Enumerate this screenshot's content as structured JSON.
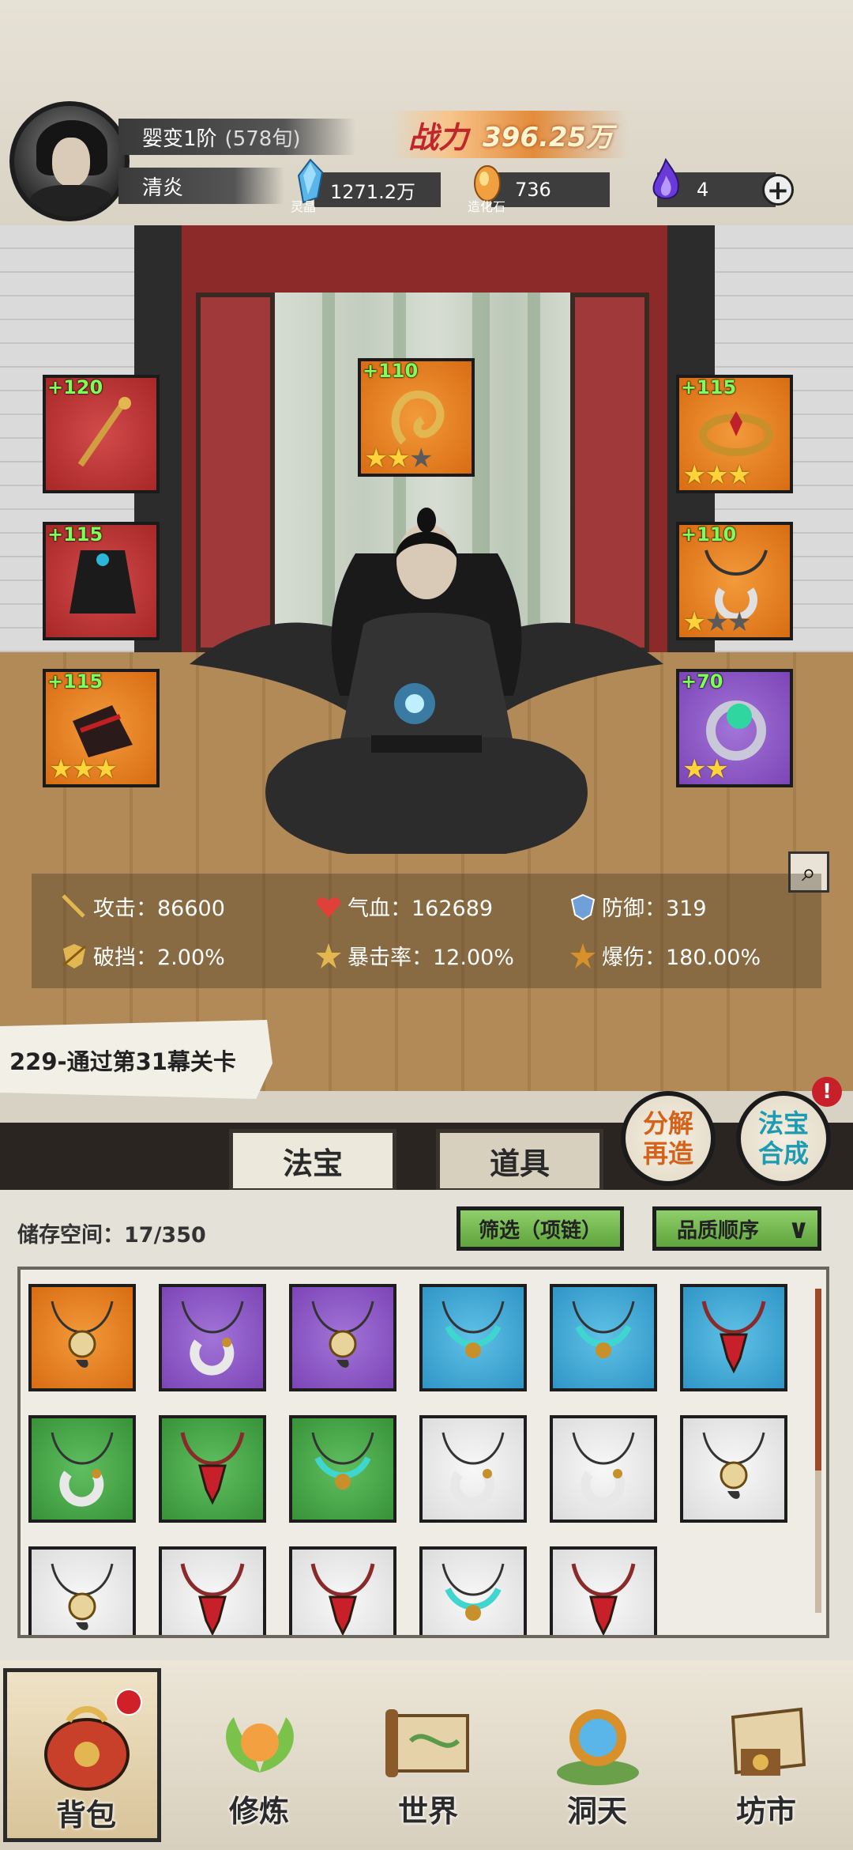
{
  "player": {
    "realm": "婴变1阶",
    "realm_sub": "(578旬)",
    "name": "清炎",
    "power_label": "战力",
    "power_value": "396.25万"
  },
  "resources": [
    {
      "icon": "spirit-crystal-icon",
      "caption": "灵晶",
      "value": "1271.2万"
    },
    {
      "icon": "creation-stone-icon",
      "caption": "造化石",
      "value": "736"
    },
    {
      "icon": "purple-flame-icon",
      "caption": "",
      "value": "4"
    }
  ],
  "equipment": {
    "left": [
      {
        "level": "+120",
        "quality": "red",
        "stars_on": 0,
        "stars_total": 0,
        "icon": "staff-icon"
      },
      {
        "level": "+115",
        "quality": "red",
        "stars_on": 0,
        "stars_total": 0,
        "icon": "robe-icon"
      },
      {
        "level": "+115",
        "quality": "orange",
        "stars_on": 3,
        "stars_total": 3,
        "icon": "boots-icon"
      }
    ],
    "center": {
      "level": "+110",
      "quality": "orange",
      "stars_on": 2,
      "stars_total": 3,
      "icon": "talisman-icon"
    },
    "right": [
      {
        "level": "+115",
        "quality": "orange",
        "stars_on": 3,
        "stars_total": 3,
        "icon": "crown-icon"
      },
      {
        "level": "+110",
        "quality": "orange",
        "stars_on": 1,
        "stars_total": 3,
        "icon": "necklace-icon"
      },
      {
        "level": "+70",
        "quality": "purple",
        "stars_on": 2,
        "stars_total": 2,
        "icon": "ring-icon"
      }
    ]
  },
  "stats": {
    "attack": "攻击：86600",
    "hp": "气血：162689",
    "defense": "防御：319",
    "break": "破挡：2.00%",
    "crit_rate": "暴击率：12.00%",
    "crit_dmg": "爆伤：180.00%"
  },
  "quest": "229-通过第31幕关卡",
  "buttons": {
    "decompose": [
      "分解",
      "再造"
    ],
    "synthesize": [
      "法宝",
      "合成"
    ],
    "alert": "!"
  },
  "tabs": [
    "法宝",
    "道具"
  ],
  "storage": {
    "label": "储存空间：17/350",
    "filter": "筛选（项链）",
    "sort": "品质顺序"
  },
  "inventory": [
    {
      "quality": "orange",
      "type": "pendant"
    },
    {
      "quality": "purple",
      "type": "crescent"
    },
    {
      "quality": "purple",
      "type": "pendant"
    },
    {
      "quality": "blue",
      "type": "serpent"
    },
    {
      "quality": "blue",
      "type": "serpent"
    },
    {
      "quality": "blue",
      "type": "red-gem"
    },
    {
      "quality": "green",
      "type": "crescent"
    },
    {
      "quality": "green",
      "type": "red-gem"
    },
    {
      "quality": "green",
      "type": "serpent"
    },
    {
      "quality": "white",
      "type": "crescent"
    },
    {
      "quality": "white",
      "type": "crescent"
    },
    {
      "quality": "white",
      "type": "pendant"
    },
    {
      "quality": "white",
      "type": "pendant"
    },
    {
      "quality": "white",
      "type": "red-gem"
    },
    {
      "quality": "white",
      "type": "red-gem"
    },
    {
      "quality": "white",
      "type": "serpent"
    },
    {
      "quality": "white",
      "type": "red-gem"
    }
  ],
  "nav": [
    {
      "label": "背包",
      "icon": "bag-icon"
    },
    {
      "label": "修炼",
      "icon": "lotus-icon"
    },
    {
      "label": "世界",
      "icon": "scroll-map-icon"
    },
    {
      "label": "洞天",
      "icon": "portal-icon"
    },
    {
      "label": "坊市",
      "icon": "market-icon"
    }
  ]
}
